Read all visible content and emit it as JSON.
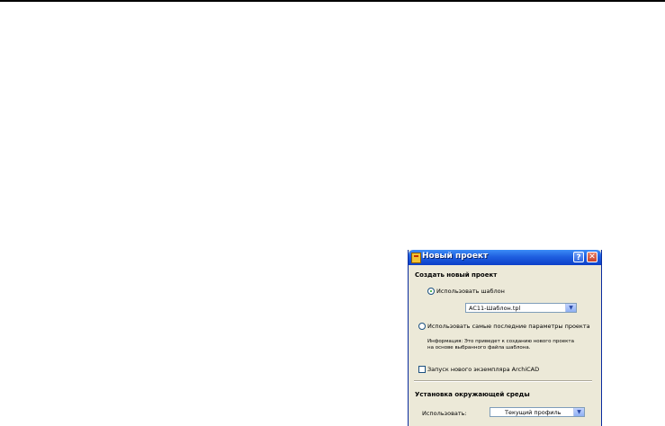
{
  "dialog": {
    "title": "Новый проект",
    "help_label": "?",
    "close_label": "✕",
    "create_section": {
      "title": "Создать новый проект",
      "use_template": {
        "label": "Использовать шаблон",
        "selected": true,
        "template_value": "AC11-Шаблон.tpl"
      },
      "use_last": {
        "label": "Использовать самые последние параметры проекта",
        "selected": false
      },
      "info_line1": "Информация: Это приведет к созданию нового проекта",
      "info_line2": "на основе выбранного файла шаблона."
    },
    "new_instance": {
      "label": "Запуск нового экземпляра ArchiCAD",
      "checked": false
    },
    "environment_section": {
      "title": "Установка окружающей среды",
      "use_label": "Использовать:",
      "profile_value": "Текущий профиль"
    },
    "icons": {
      "app": "archicad-app-icon",
      "dropdown": "chevron-down-icon"
    }
  }
}
